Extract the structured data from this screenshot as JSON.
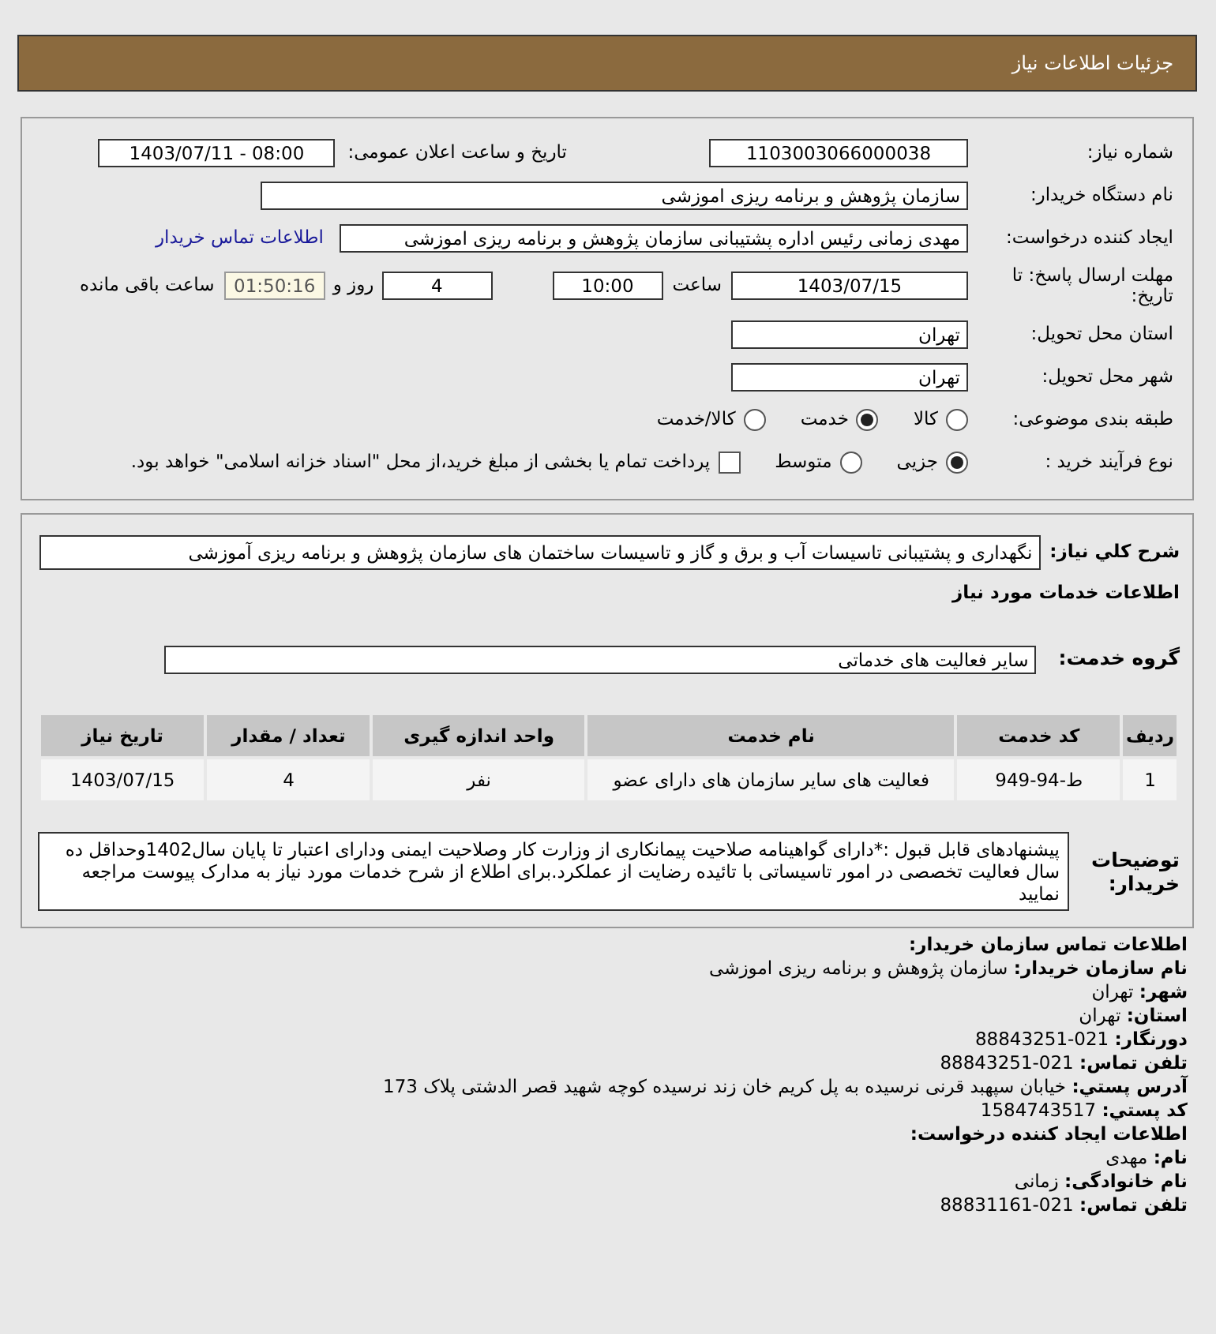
{
  "header": {
    "title": "جزئیات اطلاعات نیاز"
  },
  "form": {
    "need_number": {
      "label": "شماره نیاز:",
      "value": "1103003066000038"
    },
    "announce": {
      "label": "تاریخ و ساعت اعلان عمومی:",
      "value": "1403/07/11 - 08:00"
    },
    "buyer_org": {
      "label": "نام دستگاه خریدار:",
      "value": "سازمان پژوهش و برنامه ریزی اموزشی"
    },
    "requester": {
      "label": "ایجاد کننده درخواست:",
      "value": "مهدی زمانی رئیس اداره پشتیبانی سازمان پژوهش و برنامه ریزی اموزشی",
      "link": "اطلاعات تماس خریدار"
    },
    "deadline": {
      "label": "مهلت ارسال پاسخ: تا تاریخ:",
      "date": "1403/07/15",
      "time_label": "ساعت",
      "time": "10:00",
      "days": "4",
      "days_label": "روز و",
      "remaining": "01:50:16",
      "remaining_label": "ساعت باقی مانده"
    },
    "province": {
      "label": "استان محل تحویل:",
      "value": "تهران"
    },
    "city": {
      "label": "شهر محل تحویل:",
      "value": "تهران"
    },
    "category": {
      "label": "طبقه بندی موضوعی:",
      "options": [
        {
          "text": "کالا",
          "selected": false
        },
        {
          "text": "خدمت",
          "selected": true
        },
        {
          "text": "کالا/خدمت",
          "selected": false
        }
      ]
    },
    "purchase": {
      "label": "نوع فرآیند خرید :",
      "options": [
        {
          "text": "جزیی",
          "selected": true
        },
        {
          "text": "متوسط",
          "selected": false
        }
      ],
      "payment_option": {
        "text": "پرداخت تمام یا بخشی از مبلغ خرید،از محل \"اسناد خزانه اسلامی\" خواهد بود.",
        "checked": false
      }
    }
  },
  "details": {
    "summary": {
      "label": "شرح کلي نیاز:",
      "value": "نگهداری و پشتیبانی تاسیسات آب و برق و گاز و تاسیسات ساختمان های سازمان پژوهش و برنامه ریزی آموزشی"
    },
    "services_title": "اطلاعات خدمات مورد نیاز",
    "service_group": {
      "label": "گروه خدمت:",
      "value": "سایر فعالیت های خدماتی"
    },
    "table": {
      "columns": [
        "ردیف",
        "کد خدمت",
        "نام خدمت",
        "واحد اندازه گیری",
        "تعداد / مقدار",
        "تاریخ نیاز"
      ],
      "rows": [
        [
          "1",
          "ط-94-949",
          "فعالیت های سایر سازمان های دارای عضو",
          "نفر",
          "4",
          "1403/07/15"
        ]
      ]
    },
    "notes": {
      "label": "توضیحات خریدار:",
      "value": "پیشنهادهای قابل قبول :*دارای گواهینامه صلاحیت پیمانکاری از وزارت کار وصلاحیت ایمنی ودارای اعتبار تا پایان سال1402وحداقل ده سال فعالیت تخصصی در امور تاسیساتی با تائیده رضایت از عملکرد.برای اطلاع از شرح خدمات مورد نیاز به مدارک پیوست مراجعه نمایید"
    }
  },
  "contact": [
    {
      "kind": "heading",
      "text": "اطلاعات تماس سازمان خریدار:"
    },
    {
      "kind": "field",
      "label": "نام سازمان خریدار:",
      "value": "سازمان پژوهش و برنامه ریزی اموزشی"
    },
    {
      "kind": "field",
      "label": "شهر:",
      "value": "تهران"
    },
    {
      "kind": "field",
      "label": "استان:",
      "value": "تهران"
    },
    {
      "kind": "field",
      "label": "دورنگار:",
      "value": "88843251-021"
    },
    {
      "kind": "field",
      "label": "تلفن تماس:",
      "value": "88843251-021"
    },
    {
      "kind": "field",
      "label": "آدرس پستي:",
      "value": "خیابان سپهبد قرنی نرسیده به پل کریم خان زند نرسیده کوچه شهید قصر الدشتی پلاک 173"
    },
    {
      "kind": "field",
      "label": "کد پستي:",
      "value": "1584743517"
    },
    {
      "kind": "heading",
      "text": "اطلاعات ایجاد کننده درخواست:"
    },
    {
      "kind": "field",
      "label": "نام:",
      "value": "مهدی"
    },
    {
      "kind": "field",
      "label": "نام خانوادگی:",
      "value": "زمانی"
    },
    {
      "kind": "field",
      "label": "تلفن تماس:",
      "value": "88831161-021"
    }
  ]
}
